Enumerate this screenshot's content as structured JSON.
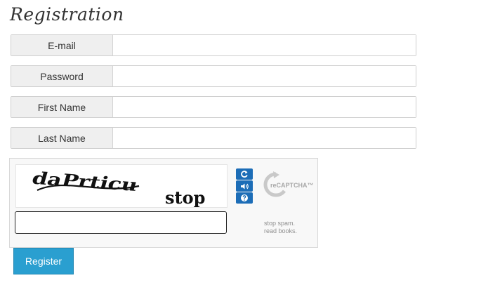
{
  "page": {
    "title": "Registration"
  },
  "form": {
    "fields": [
      {
        "label": "E-mail",
        "value": ""
      },
      {
        "label": "Password",
        "value": ""
      },
      {
        "label": "First Name",
        "value": ""
      },
      {
        "label": "Last Name",
        "value": ""
      }
    ],
    "submit_label": "Register"
  },
  "captcha": {
    "challenge_words": [
      "daPrticu",
      "stop"
    ],
    "response_value": "",
    "logo_text": "reCAPTCHA™",
    "tagline_lines": [
      "stop spam.",
      "read books."
    ],
    "controls": [
      "refresh-icon",
      "audio-icon",
      "help-icon"
    ]
  },
  "colors": {
    "accent": "#2a9fd0",
    "recaptcha_blue": "#1c6db7",
    "label_bg": "#efefef"
  }
}
